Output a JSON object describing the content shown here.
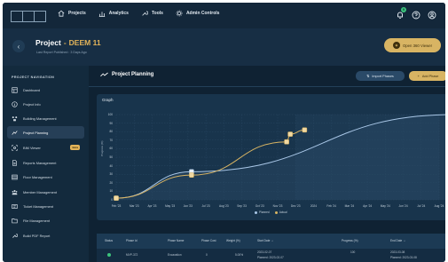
{
  "colors": {
    "accent": "#d8b463",
    "planned": "#a8c6e6",
    "actual": "#d8b463",
    "background": "#0f2233"
  },
  "topnav": {
    "items": [
      {
        "label": "Projects",
        "icon": "home-icon"
      },
      {
        "label": "Analytics",
        "icon": "bar-chart-icon"
      },
      {
        "label": "Tools",
        "icon": "wrench-icon"
      },
      {
        "label": "Admin Controls",
        "icon": "gear-icon"
      }
    ],
    "notification_count": "9"
  },
  "project": {
    "label": "Project",
    "separator": "-",
    "code": "DEEM 11",
    "subtitle": "Last Report Published : 3 Days Ago",
    "viewer_button": "Open 360 Viewer"
  },
  "sidebar": {
    "title": "PROJECT NAVIGATION",
    "items": [
      {
        "label": "Dashboard",
        "icon": "dashboard-icon"
      },
      {
        "label": "Project Info",
        "icon": "info-icon"
      },
      {
        "label": "Building Management",
        "icon": "building-icon"
      },
      {
        "label": "Project Planning",
        "icon": "trend-icon",
        "active": true
      },
      {
        "label": "BIM Viewer",
        "icon": "bim-icon",
        "badge": "Beta"
      },
      {
        "label": "Reports Management",
        "icon": "report-icon"
      },
      {
        "label": "Floor Management",
        "icon": "floor-icon"
      },
      {
        "label": "Member Management",
        "icon": "members-icon"
      },
      {
        "label": "Ticket Management",
        "icon": "ticket-icon"
      },
      {
        "label": "File Management",
        "icon": "folder-icon"
      },
      {
        "label": "Build PDF Report",
        "icon": "tool-icon"
      }
    ]
  },
  "main": {
    "title": "Project Planning",
    "import_button": "Import Phases",
    "add_button": "Add Phase"
  },
  "chart_data": {
    "type": "line",
    "title": "Graph",
    "ylabel": "Progress (%)",
    "ylim": [
      0,
      100
    ],
    "yticks": [
      "100",
      "90",
      "80",
      "70",
      "60",
      "50",
      "40",
      "30",
      "20",
      "10",
      "0"
    ],
    "categories": [
      "Feb '23",
      "Mar '23",
      "Apr '23",
      "May '23",
      "Jun '23",
      "Jul '23",
      "Aug '23",
      "Sep '23",
      "Oct '23",
      "Nov '23",
      "Dec '23",
      "2024",
      "Feb '24",
      "Mar '24",
      "Apr '24",
      "May '24",
      "Jun '24",
      "Jul '24",
      "Aug '24"
    ],
    "legend_position": "bottom",
    "series": [
      {
        "name": "Planned",
        "x": [
          0,
          4.2,
          18.8
        ],
        "values": [
          2,
          33,
          100
        ],
        "marker_labels": [
          "",
          "",
          ""
        ]
      },
      {
        "name": "Actual",
        "x": [
          0,
          4.2,
          9.5,
          9.7,
          10.5
        ],
        "values": [
          2,
          29,
          68,
          77,
          82
        ],
        "marker_labels": [
          "",
          "",
          "",
          "",
          ""
        ]
      }
    ],
    "projection_start_index": 10
  },
  "table": {
    "headers": [
      "Status",
      "Phase Id",
      "Phase Name",
      "Phase Cost",
      "Weight (%)",
      "Start Date",
      "Progress (%)",
      "End Date"
    ],
    "rows": [
      {
        "phase_id": "MVP-372",
        "phase_name": "Excavation",
        "phase_cost": "0",
        "weight": "5.00%",
        "start_date": "2023-02-07",
        "start_planned": "Planned: 2023-02-07",
        "progress": "100",
        "end_date": "2023-03-08",
        "end_planned": "Planned: 2023-03-08"
      }
    ]
  }
}
